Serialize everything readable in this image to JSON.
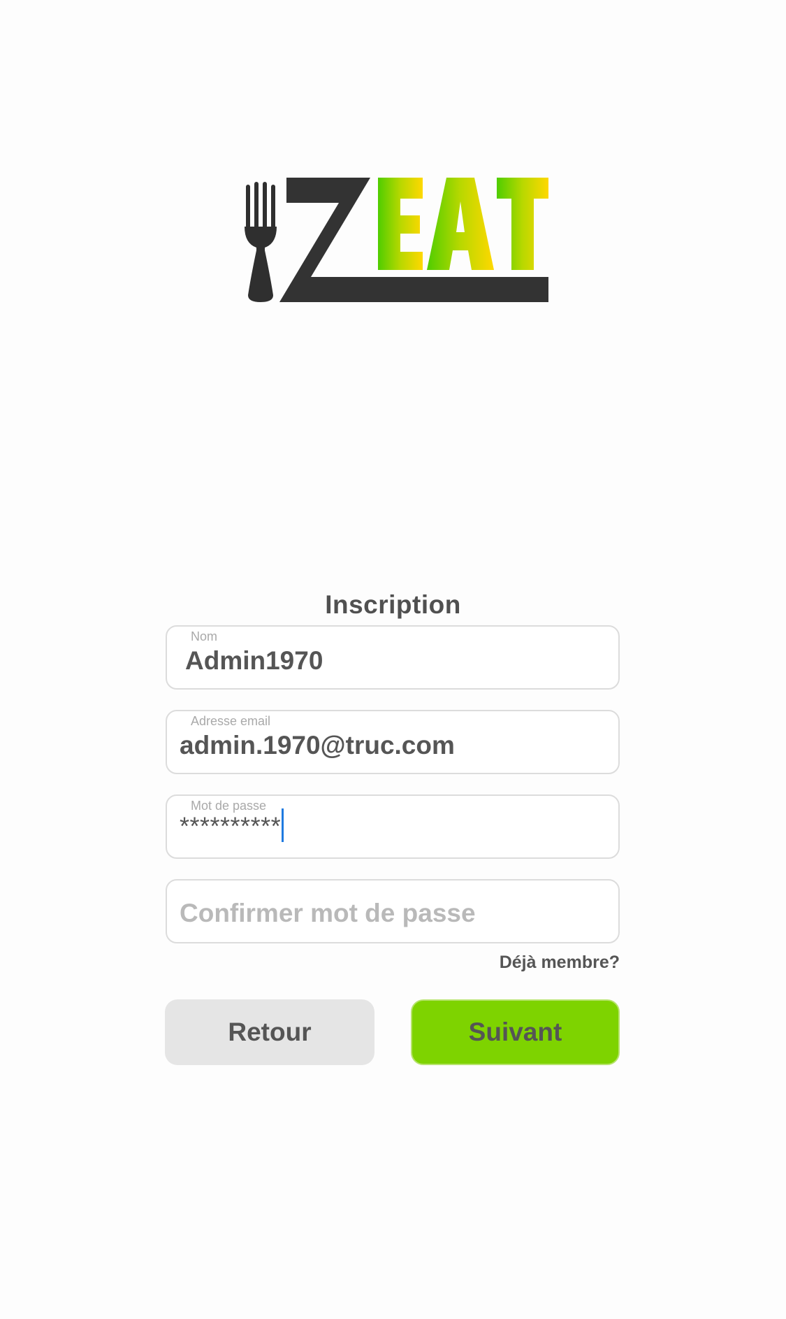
{
  "brand": {
    "logo_text": "ZEAT",
    "icon": "fork-icon",
    "colors": {
      "dark": "#333333",
      "green": "#5ccf00",
      "yellow": "#ffd700"
    }
  },
  "form": {
    "title": "Inscription",
    "name_field": {
      "label": "Nom",
      "value": "Admin1970"
    },
    "email_field": {
      "label": "Adresse email",
      "value": "admin.1970@truc.com"
    },
    "password_field": {
      "label": "Mot de passe",
      "value": "**********"
    },
    "confirm_field": {
      "placeholder": "Confirmer mot de passe",
      "value": ""
    },
    "already_member_link": "Déjà membre?"
  },
  "buttons": {
    "back_label": "Retour",
    "next_label": "Suivant",
    "next_color": "#7ed300"
  }
}
